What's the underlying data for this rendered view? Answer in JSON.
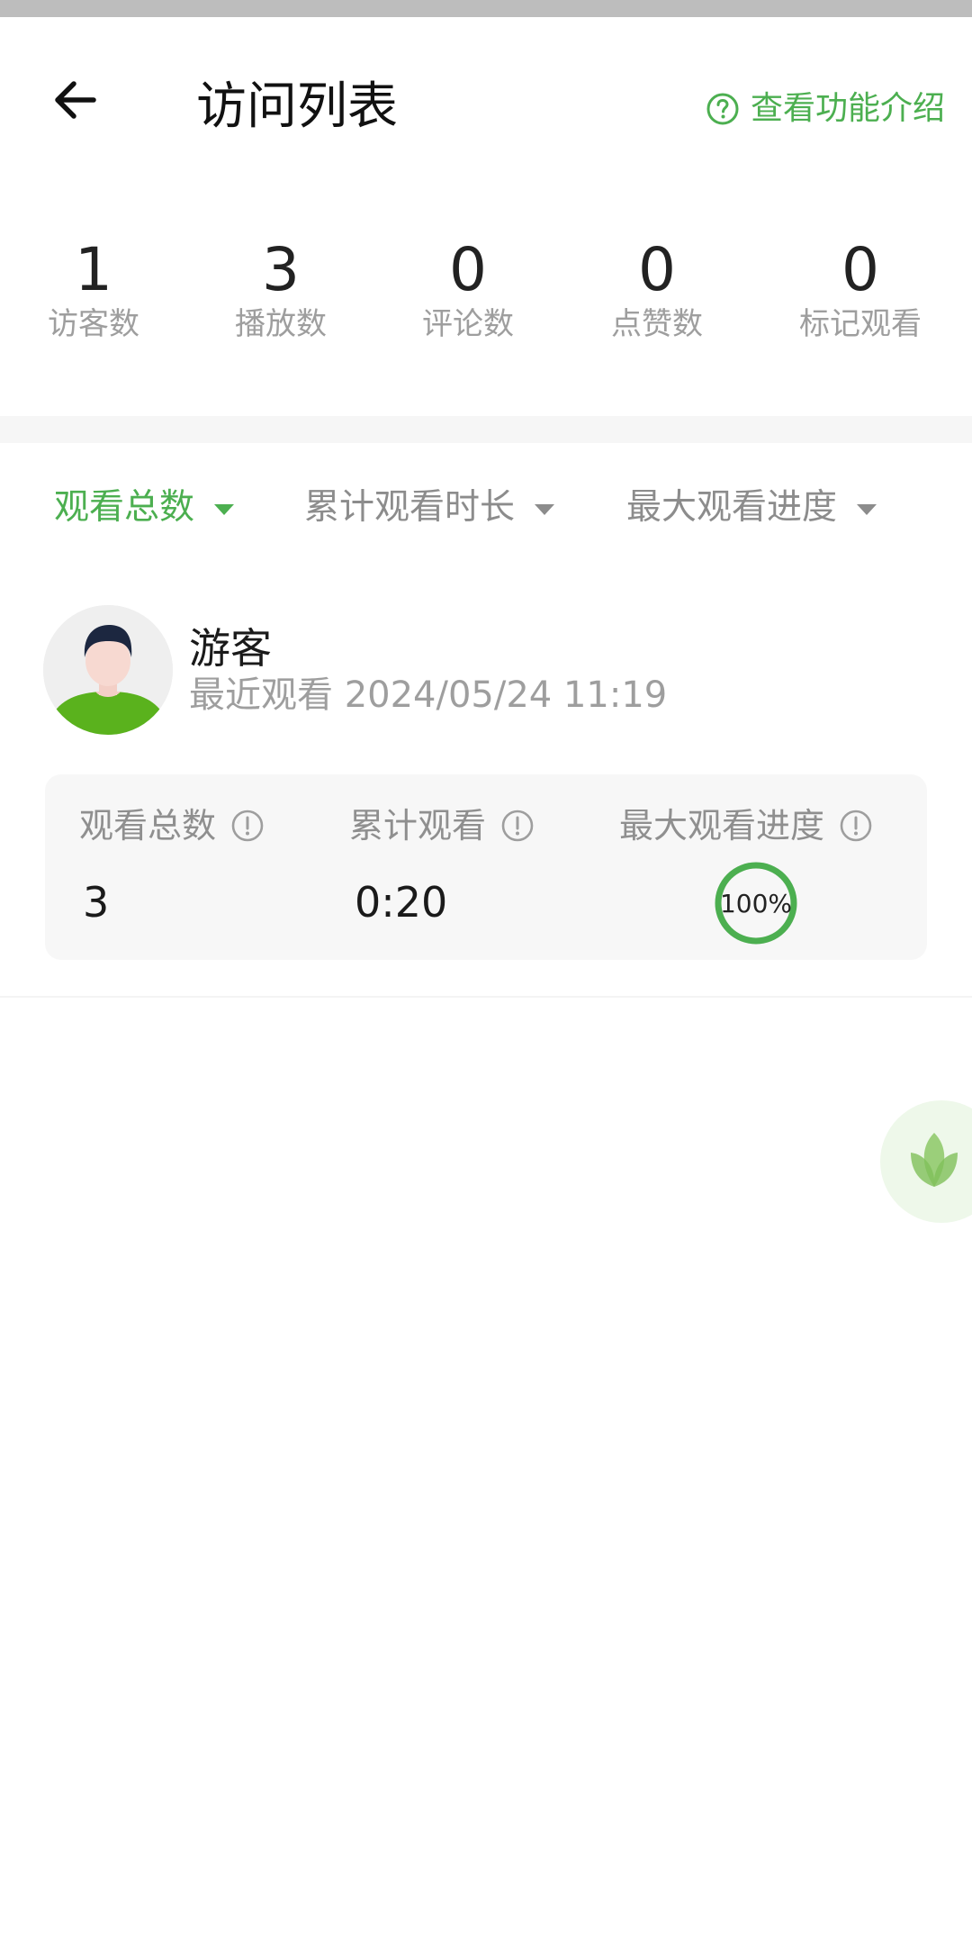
{
  "header": {
    "title": "访问列表",
    "help_text": "查看功能介绍"
  },
  "stats": [
    {
      "value": "1",
      "label": "访客数"
    },
    {
      "value": "3",
      "label": "播放数"
    },
    {
      "value": "0",
      "label": "评论数"
    },
    {
      "value": "0",
      "label": "点赞数"
    },
    {
      "value": "0",
      "label": "标记观看"
    }
  ],
  "filters": [
    {
      "label": "观看总数",
      "active": true
    },
    {
      "label": "累计观看时长",
      "active": false
    },
    {
      "label": "最大观看进度",
      "active": false
    }
  ],
  "visitor": {
    "name": "游客",
    "recent": "最近观看 2024/05/24 11:19",
    "metrics": [
      {
        "label": "观看总数",
        "value": "3"
      },
      {
        "label": "累计观看",
        "value": "0:20"
      },
      {
        "label": "最大观看进度",
        "value": "100%",
        "progress": 1.0
      }
    ]
  },
  "colors": {
    "accent": "#4caf50",
    "muted": "#9e9e9e",
    "card_bg": "#f7f7f7"
  },
  "icons": [
    "arrow-left-icon",
    "question-circle-icon",
    "caret-down-icon",
    "info-circle-icon",
    "lotus-icon"
  ]
}
